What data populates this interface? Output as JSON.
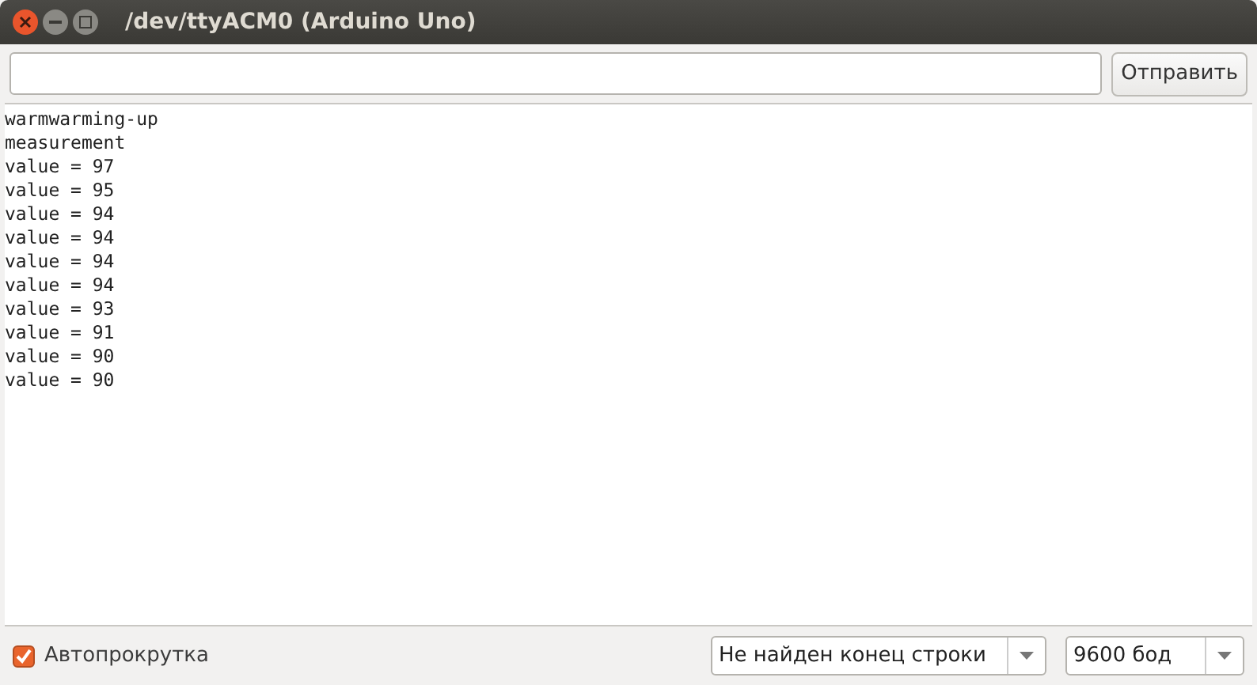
{
  "window": {
    "title": "/dev/ttyACM0 (Arduino Uno)"
  },
  "send_button": {
    "label": "Отправить"
  },
  "output": {
    "lines": [
      "warmwarming-up",
      "measurement",
      "value = 97",
      "value = 95",
      "value = 94",
      "value = 94",
      "value = 94",
      "value = 94",
      "value = 93",
      "value = 91",
      "value = 90",
      "value = 90"
    ]
  },
  "autoscroll": {
    "label": "Автопрокрутка",
    "checked": true
  },
  "line_ending": {
    "value": "Не найден конец строки"
  },
  "baud_rate": {
    "value": "9600 бод"
  }
}
